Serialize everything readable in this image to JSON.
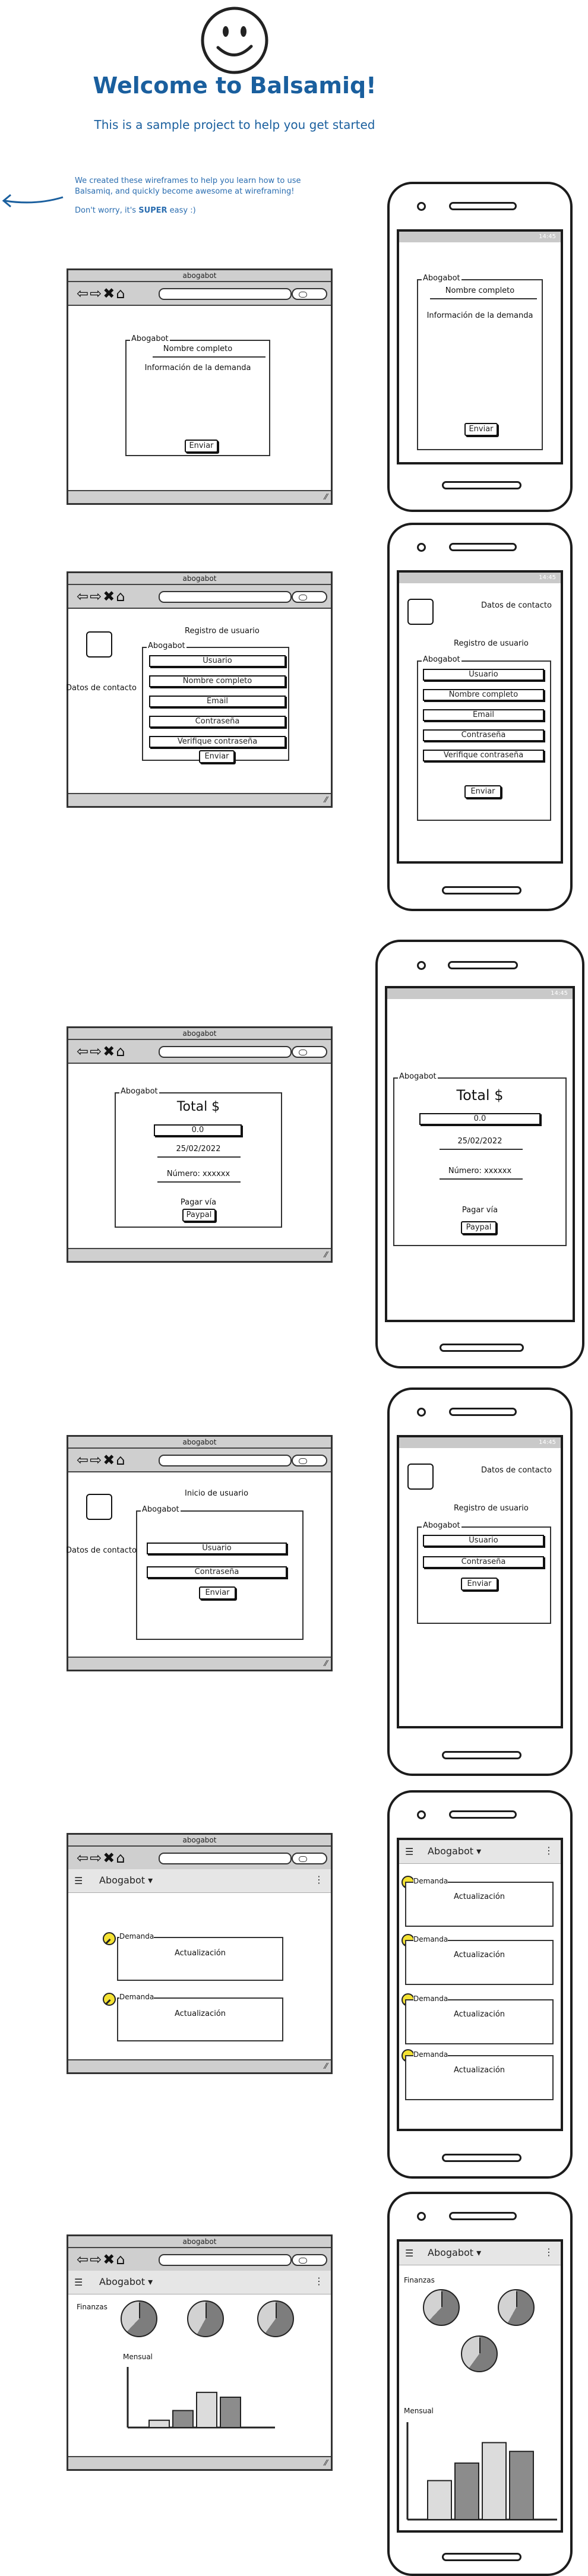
{
  "header": {
    "title": "Welcome to Balsamiq!",
    "subtitle": "This is a sample project to help you get started",
    "intro_line1": "We created these wireframes to help you learn how to use Balsamiq, and quickly become awesome at wireframing!",
    "intro_line2_prefix": "Don't worry, it's ",
    "intro_line2_bold": "SUPER",
    "intro_line2_suffix": " easy :)"
  },
  "browser": {
    "title": "abogabot",
    "nav_icons": "⇦⇨✖⌂"
  },
  "phone": {
    "status_time": "14:45"
  },
  "screens": {
    "demanda": {
      "group_label": "Abogabot",
      "full_name": "Nombre completo",
      "demand_info": "Información de la demanda",
      "submit": "Enviar"
    },
    "registro": {
      "contact": "Datos de contacto",
      "heading": "Registro de usuario",
      "group_label": "Abogabot",
      "fields": [
        "Usuario",
        "Nombre completo",
        "Email",
        "Contraseña",
        "Verifique contraseña"
      ],
      "submit": "Enviar"
    },
    "pago": {
      "group_label": "Abogabot",
      "total": "Total $",
      "amount": "0.0",
      "date": "25/02/2022",
      "number": "Número: xxxxxx",
      "pay_via": "Pagar vía",
      "pay_button": "Paypal"
    },
    "login": {
      "contact": "Datos de contacto",
      "heading": "Inicio de usuario",
      "heading_mobile": "Registro de usuario",
      "group_label": "Abogabot",
      "fields": [
        "Usuario",
        "Contraseña"
      ],
      "submit": "Enviar"
    },
    "demandas": {
      "app_name": "Abogabot",
      "card_label": "Demanda",
      "card_text": "Actualización"
    },
    "finanzas": {
      "app_name": "Abogabot",
      "section_label": "Finanzas",
      "chart_label": "Mensual",
      "pie_values": [
        0.62,
        0.58,
        0.6
      ],
      "bar_values_desktop": [
        12,
        28,
        58,
        50
      ],
      "bar_values_mobile": [
        40,
        58,
        79,
        70
      ],
      "bar_colors": [
        "#dcdcdc",
        "#8c8c8c",
        "#dcdcdc",
        "#8c8c8c"
      ]
    }
  }
}
